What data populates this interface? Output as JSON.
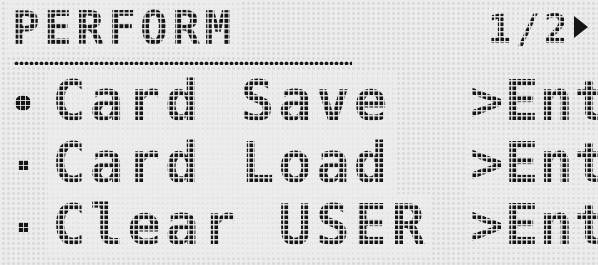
{
  "screen": {
    "title": "PERFORM",
    "page_indicator": "1/2",
    "page_arrow_icon": "right-arrow-icon"
  },
  "menu": {
    "selected_index": 0,
    "items": [
      {
        "label": "Card Save",
        "action": ">Ent",
        "selected": true
      },
      {
        "label": "Card Load",
        "action": ">Ent",
        "selected": false
      },
      {
        "label": "Clear USER",
        "action": ">Ent",
        "selected": false
      }
    ]
  },
  "colors": {
    "lcd_background": "#ececec",
    "pixel_on": "#151515",
    "pixel_off": "#d6d6d6"
  }
}
